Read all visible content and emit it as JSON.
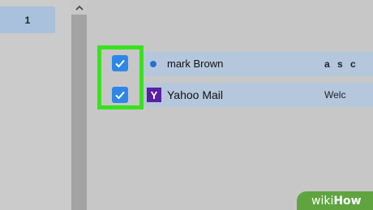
{
  "pagination": {
    "current_page": "1"
  },
  "scrollbar": {
    "up_arrow_icon": "chevron-up-icon"
  },
  "messages": [
    {
      "sender": "mark Brown",
      "subject": "a s c",
      "selected": true,
      "unread": true,
      "icon": "unread-dot-icon"
    },
    {
      "sender": "Yahoo Mail",
      "subject": "Welc",
      "selected": true,
      "unread": false,
      "icon": "yahoo-logo-icon",
      "icon_letter": "Y"
    }
  ],
  "highlight": {
    "color": "#38e21f"
  },
  "watermark": {
    "prefix": "wiki",
    "suffix": "How"
  },
  "colors": {
    "checkbox": "#2e86e8",
    "row_selected": "#b5c7dc",
    "yahoo": "#5a1fa3"
  }
}
